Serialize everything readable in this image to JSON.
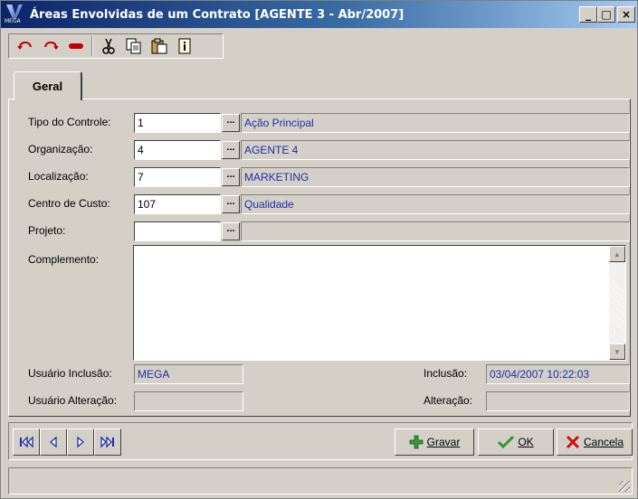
{
  "window": {
    "title": "Áreas Envolvidas de um Contrato [AGENTE 3 - Abr/2007]",
    "app_icon_text": "MEGA",
    "minimize": "_",
    "maximize": "□",
    "close": "×"
  },
  "toolbar": {
    "items": [
      "undo-icon",
      "redo-icon",
      "delete-icon",
      "cut-icon",
      "copy-icon",
      "paste-icon",
      "info-icon"
    ]
  },
  "tabs": [
    {
      "label": "Geral",
      "active": true
    }
  ],
  "form": {
    "tipo_controle": {
      "label": "Tipo do Controle:",
      "value": "1",
      "description": "Ação Principal"
    },
    "organizacao": {
      "label": "Organização:",
      "value": "4",
      "description": "AGENTE 4"
    },
    "localizacao": {
      "label": "Localização:",
      "value": "7",
      "description": "MARKETING"
    },
    "centro_custo": {
      "label": "Centro de Custo:",
      "value": "107",
      "description": "Qualidade"
    },
    "projeto": {
      "label": "Projeto:",
      "value": "",
      "description": ""
    },
    "complemento": {
      "label": "Complemento:",
      "value": ""
    },
    "usuario_inclusao": {
      "label": "Usuário Inclusão:",
      "value": "MEGA"
    },
    "usuario_alteracao": {
      "label": "Usuário Alteração:",
      "value": ""
    },
    "inclusao": {
      "label": "Inclusão:",
      "value": "03/04/2007 10:22:03"
    },
    "alteracao": {
      "label": "Alteração:",
      "value": ""
    },
    "lookup_button": "..."
  },
  "actions": {
    "gravar": "Gravar",
    "ok": "OK",
    "cancela": "Cancela"
  },
  "colors": {
    "title_start": "#0a246a",
    "title_end": "#a6caf0",
    "face": "#d4d0c8",
    "value_text": "#1c2fa8"
  }
}
